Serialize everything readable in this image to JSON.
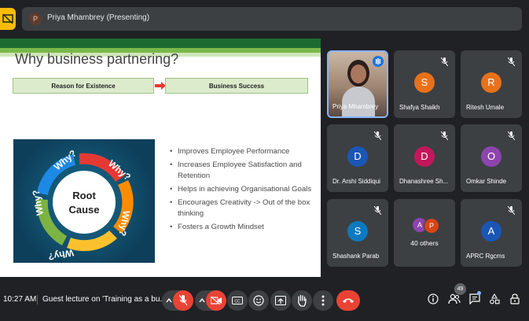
{
  "presenter_bar": {
    "avatar_letter": "P",
    "label": "Priya Mhambrey (Presenting)"
  },
  "slide": {
    "title": "Why business partnering?",
    "reason_header": "Reason for Existence",
    "success_header": "Business Success",
    "diagram": {
      "center_line1": "Root",
      "center_line2": "Cause",
      "segment_label": "Why?"
    },
    "bullets": [
      "Improves Employee Performance",
      "Increases Employee Satisfaction and Retention",
      "Helps in achieving Organisational Goals",
      "Encourages Creativity -> Out of the box thinking",
      "Fosters a Growth Mindset"
    ]
  },
  "participants": [
    {
      "name": "Priya Mhambrey",
      "letter": "",
      "color": "",
      "speaking": true
    },
    {
      "name": "Shafya Shaikh",
      "letter": "S",
      "color": "#e8711a"
    },
    {
      "name": "Ritesh Umale",
      "letter": "R",
      "color": "#e8711a"
    },
    {
      "name": "Dr. Arshi Siddiqui",
      "letter": "D",
      "color": "#1a56b4"
    },
    {
      "name": "Dhanashree Sh...",
      "letter": "D",
      "color": "#c2185b"
    },
    {
      "name": "Omkar Shinde",
      "letter": "O",
      "color": "#8e44ad"
    },
    {
      "name": "Shashank Parab",
      "letter": "S",
      "color": "#0b79c0"
    },
    {
      "name": "40 others",
      "letter": "",
      "color": ""
    },
    {
      "name": "APRC Rgcms",
      "letter": "A",
      "color": "#1a56b4"
    }
  ],
  "others_avatars": [
    {
      "letter": "A",
      "color": "#8e44ad"
    },
    {
      "letter": "P",
      "color": "#d84315"
    }
  ],
  "bottom_bar": {
    "time": "10:27 AM",
    "meeting_title": "Guest lecture on 'Training as a bu...",
    "participant_count": "49"
  },
  "colors": {
    "background": "#202124",
    "tile": "#3c4043",
    "danger": "#ea4335",
    "accent": "#8ab4f8",
    "present": "#fbbc04"
  },
  "icons": [
    "present-icon",
    "mic-off-icon",
    "camera-off-icon",
    "captions-icon",
    "emoji-icon",
    "present-screen-icon",
    "raise-hand-icon",
    "more-icon",
    "hang-up-icon",
    "info-icon",
    "people-icon",
    "chat-icon",
    "activities-icon",
    "host-controls-icon"
  ]
}
